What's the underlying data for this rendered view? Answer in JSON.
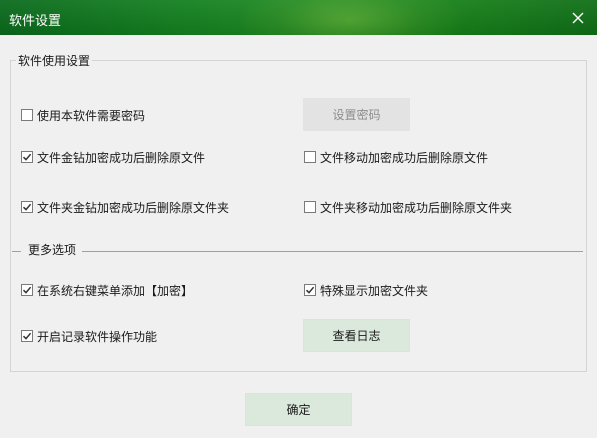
{
  "window": {
    "title": "软件设置"
  },
  "usage_section": {
    "legend": "软件使用设置",
    "require_password": {
      "label": "使用本软件需要密码",
      "checked": false
    },
    "set_password_button": "设置密码",
    "gold_delete_file": {
      "label": "文件金钻加密成功后删除原文件",
      "checked": true
    },
    "move_delete_file": {
      "label": "文件移动加密成功后删除原文件",
      "checked": false
    },
    "gold_delete_folder": {
      "label": "文件夹金钻加密成功后删除原文件夹",
      "checked": true
    },
    "move_delete_folder": {
      "label": "文件夹移动加密成功后删除原文件夹",
      "checked": false
    }
  },
  "more_section": {
    "label": "更多选项",
    "context_menu": {
      "label": "在系统右键菜单添加【加密】",
      "checked": true
    },
    "special_display": {
      "label": "特殊显示加密文件夹",
      "checked": true
    },
    "record_operations": {
      "label": "开启记录软件操作功能",
      "checked": true
    },
    "view_log_button": "查看日志"
  },
  "footer": {
    "confirm_button": "确定"
  },
  "colors": {
    "titlebar_accent": "#13801f",
    "button_bg": "#dbe8dc",
    "check_color": "#333333"
  },
  "icons": {
    "close": "close-icon",
    "check": "checkmark-icon"
  }
}
